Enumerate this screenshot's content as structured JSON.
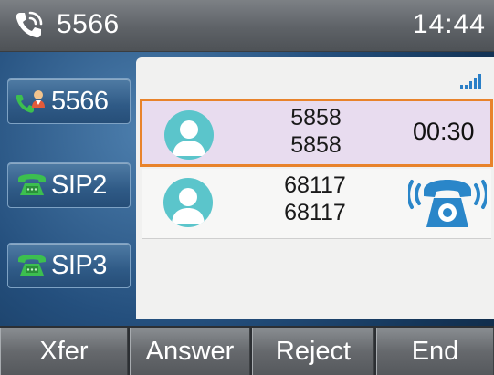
{
  "header": {
    "account": "5566",
    "time": "14:44",
    "icon": "phone-call-icon"
  },
  "line_keys": [
    {
      "label": "5566",
      "icon": "contact-handset-icon",
      "status": "active"
    },
    {
      "label": "SIP2",
      "icon": "green-phone-icon",
      "status": "idle"
    },
    {
      "label": "SIP3",
      "icon": "green-phone-icon",
      "status": "idle"
    }
  ],
  "calls": [
    {
      "name": "5858",
      "number": "5858",
      "duration": "00:30",
      "selected": true
    },
    {
      "name": "68117",
      "number": "68117",
      "state_icon": "ringing-phone-icon",
      "selected": false
    }
  ],
  "softkeys": [
    "Xfer",
    "Answer",
    "Reject",
    "End"
  ],
  "colors": {
    "highlight_border": "#e8832b",
    "highlight_fill": "#e8dcef",
    "avatar": "#5bc5cb",
    "ring_icon": "#2a86c9",
    "line_icon": "#3cbf4f"
  }
}
